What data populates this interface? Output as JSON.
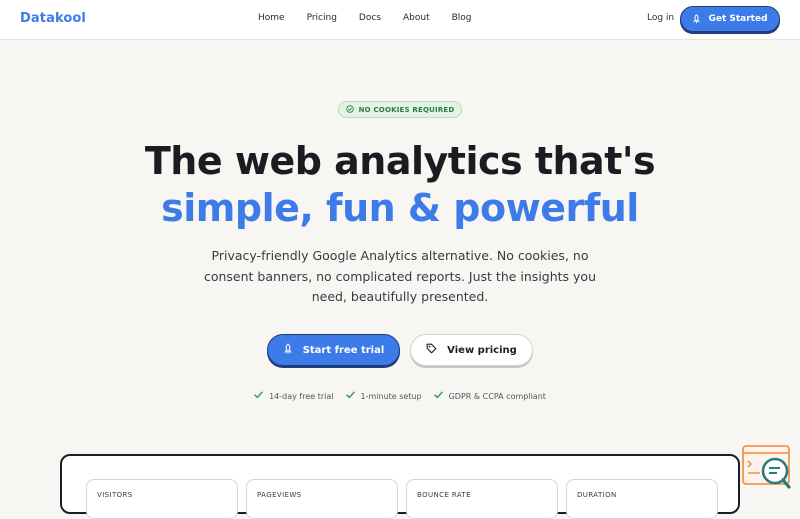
{
  "nav": {
    "brand": "Datakool",
    "links": [
      "Home",
      "Pricing",
      "Docs",
      "About",
      "Blog"
    ],
    "login": "Log in",
    "cta": "Get Started"
  },
  "hero": {
    "badge": "NO COOKIES REQUIRED",
    "title": "The web analytics that's",
    "title_accent": "simple, fun & powerful",
    "subtitle": "Privacy-friendly Google Analytics alternative. No cookies, no consent banners, no complicated reports. Just the insights you need, beautifully presented.",
    "primary_button": "Start free trial",
    "secondary_button": "View pricing",
    "features": [
      "14-day free trial",
      "1-minute setup",
      "GDPR & CCPA compliant"
    ]
  },
  "dashboard": {
    "metrics": [
      "VISITORS",
      "PAGEVIEWS",
      "BOUNCE RATE",
      "DURATION"
    ]
  },
  "colors": {
    "accent": "#3d7ce8",
    "background": "#f7f6f3",
    "text": "#1b1c22",
    "badge_green": "#2e7d3e"
  },
  "icons": {
    "cta": "rocket-icon",
    "badge": "shield-icon",
    "pricing": "tag-icon",
    "feature": "check-icon",
    "widget": "search-chat-icon"
  }
}
